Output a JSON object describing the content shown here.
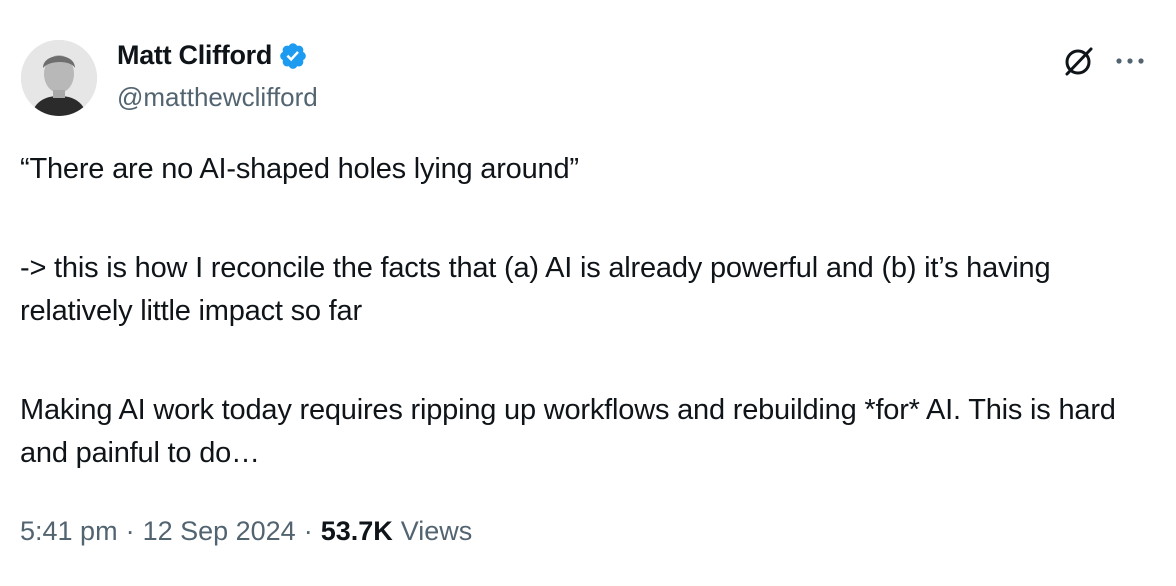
{
  "author": {
    "name": "Matt Clifford",
    "handle": "@matthewclifford",
    "verified_color": "#1d9bf0"
  },
  "header_icons": [
    "grok-icon",
    "more-icon"
  ],
  "tweet": {
    "lines": [
      "“There are no AI-shaped holes lying around”",
      "-> this is how I reconcile the facts that (a) AI is already powerful and (b) it’s having relatively little impact so far",
      "Making AI work today requires ripping up workflows and rebuilding *for* AI. This is hard and painful to do…"
    ]
  },
  "meta": {
    "time": "5:41 pm",
    "separator": "·",
    "date": "12 Sep 2024",
    "views_count": "53.7K",
    "views_label": "Views"
  }
}
